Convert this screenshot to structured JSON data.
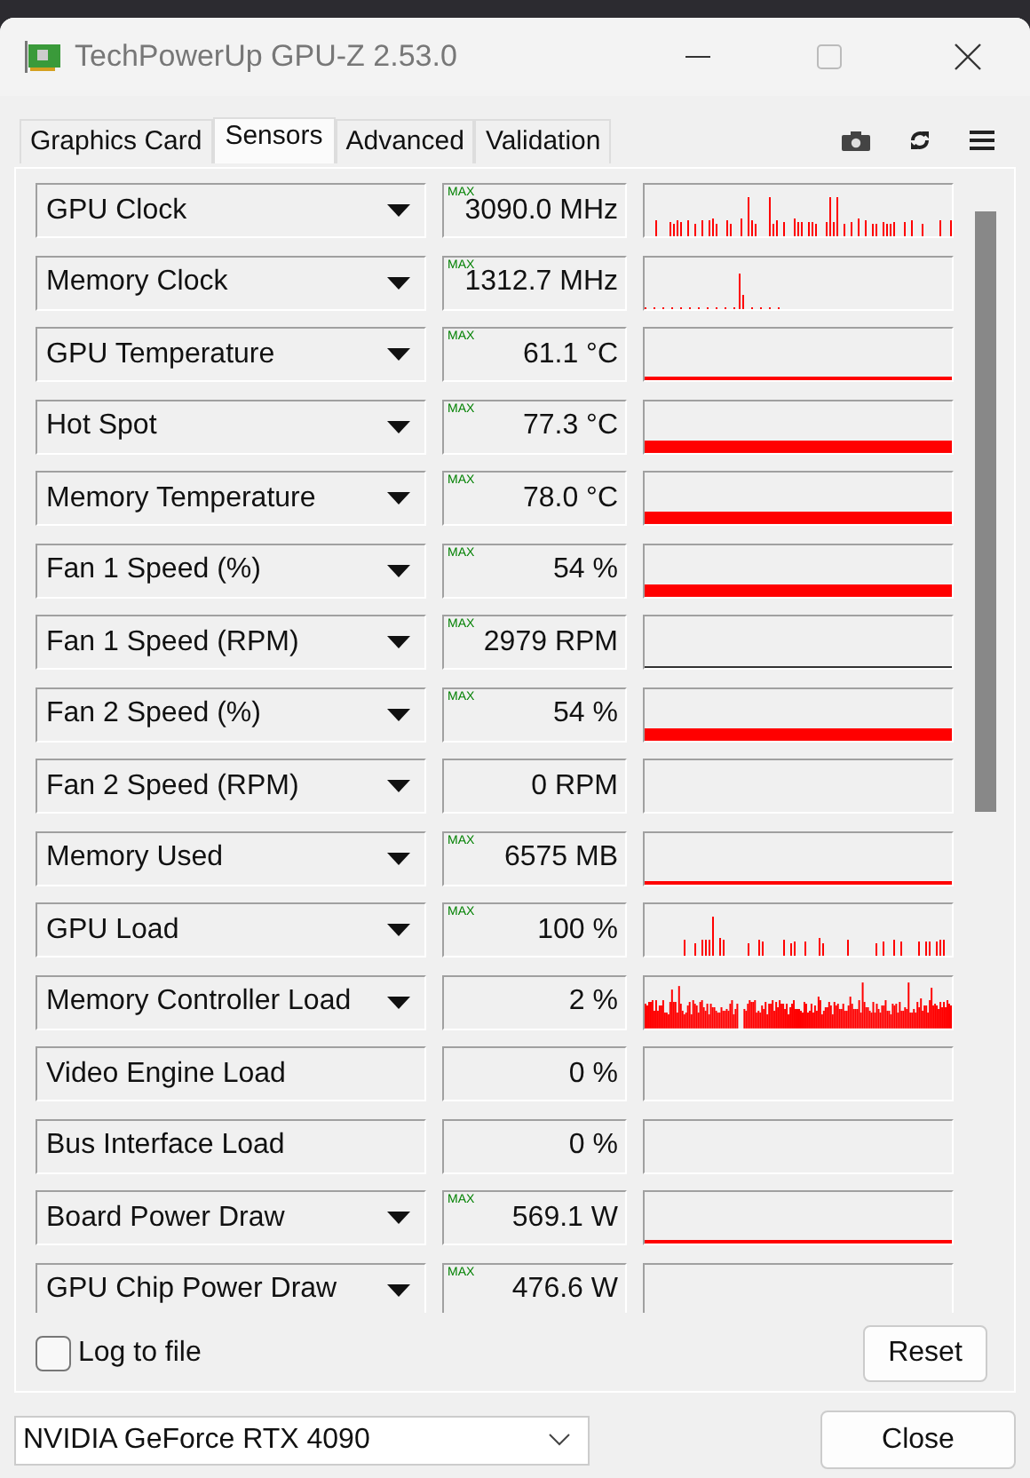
{
  "window": {
    "title": "TechPowerUp GPU-Z 2.53.0"
  },
  "tabs": [
    {
      "label": "Graphics Card",
      "selected": false
    },
    {
      "label": "Sensors",
      "selected": true
    },
    {
      "label": "Advanced",
      "selected": false
    },
    {
      "label": "Validation",
      "selected": false
    }
  ],
  "sensors": [
    {
      "name": "GPU Clock",
      "has_menu": true,
      "badge": "MAX",
      "value": "3090.0 MHz",
      "kind": "spiky"
    },
    {
      "name": "Memory Clock",
      "has_menu": true,
      "badge": "MAX",
      "value": "1312.7 MHz",
      "kind": "sparse"
    },
    {
      "name": "GPU Temperature",
      "has_menu": true,
      "badge": "MAX",
      "value": "61.1 °C",
      "kind": "line"
    },
    {
      "name": "Hot Spot",
      "has_menu": true,
      "badge": "MAX",
      "value": "77.3 °C",
      "kind": "band"
    },
    {
      "name": "Memory Temperature",
      "has_menu": true,
      "badge": "MAX",
      "value": "78.0 °C",
      "kind": "band"
    },
    {
      "name": "Fan 1 Speed (%)",
      "has_menu": true,
      "badge": "MAX",
      "value": "54 %",
      "kind": "band"
    },
    {
      "name": "Fan 1 Speed (RPM)",
      "has_menu": true,
      "badge": "MAX",
      "value": "2979 RPM",
      "kind": "thin"
    },
    {
      "name": "Fan 2 Speed (%)",
      "has_menu": true,
      "badge": "MAX",
      "value": "54 %",
      "kind": "band"
    },
    {
      "name": "Fan 2 Speed (RPM)",
      "has_menu": true,
      "value": "0 RPM",
      "kind": "none"
    },
    {
      "name": "Memory Used",
      "has_menu": true,
      "badge": "MAX",
      "value": "6575 MB",
      "kind": "line"
    },
    {
      "name": "GPU Load",
      "has_menu": true,
      "badge": "MAX",
      "value": "100 %",
      "kind": "spiky"
    },
    {
      "name": "Memory Controller Load",
      "has_menu": true,
      "value": "2 %",
      "kind": "dense"
    },
    {
      "name": "Video Engine Load",
      "has_menu": false,
      "value": "0 %",
      "kind": "none"
    },
    {
      "name": "Bus Interface Load",
      "has_menu": false,
      "value": "0 %",
      "kind": "none"
    },
    {
      "name": "Board Power Draw",
      "has_menu": true,
      "badge": "MAX",
      "value": "569.1 W",
      "kind": "line"
    },
    {
      "name": "GPU Chip Power Draw",
      "has_menu": true,
      "badge": "MAX",
      "value": "476.6 W",
      "kind": "none"
    }
  ],
  "log_to_file": {
    "label": "Log to file",
    "checked": false
  },
  "reset_button": "Reset",
  "gpu_select": {
    "value": "NVIDIA GeForce RTX 4090"
  },
  "close_button": "Close"
}
